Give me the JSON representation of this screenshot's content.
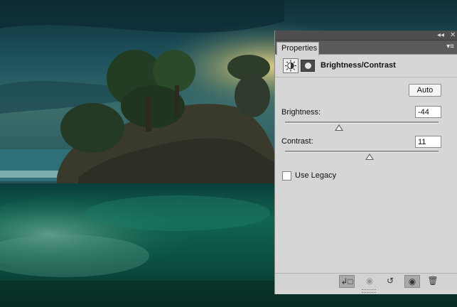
{
  "panel": {
    "tab_label": "Properties",
    "collapse_glyph": "◂◂",
    "close_glyph": "✕",
    "menu_glyph": "▾≡",
    "adjustment_title": "Brightness/Contrast",
    "header_icons": [
      "brightness-contrast-icon",
      "layer-mask-icon"
    ],
    "auto_label": "Auto",
    "brightness": {
      "label": "Brightness:",
      "value": "-44",
      "level": 0.35
    },
    "contrast": {
      "label": "Contrast:",
      "value": "11",
      "level": 0.55
    },
    "legacy": {
      "label": "Use Legacy",
      "checked": false
    },
    "footer_icons": [
      "clip-to-layer-icon",
      "view-previous-state-icon",
      "reset-icon",
      "visibility-eye-icon",
      "trash-icon"
    ]
  },
  "colors": {
    "panel_bg": "#d6d6d6",
    "tab_bar": "#5a5a5a",
    "sky": "#1f4a52",
    "sea": "#0e5a45"
  }
}
